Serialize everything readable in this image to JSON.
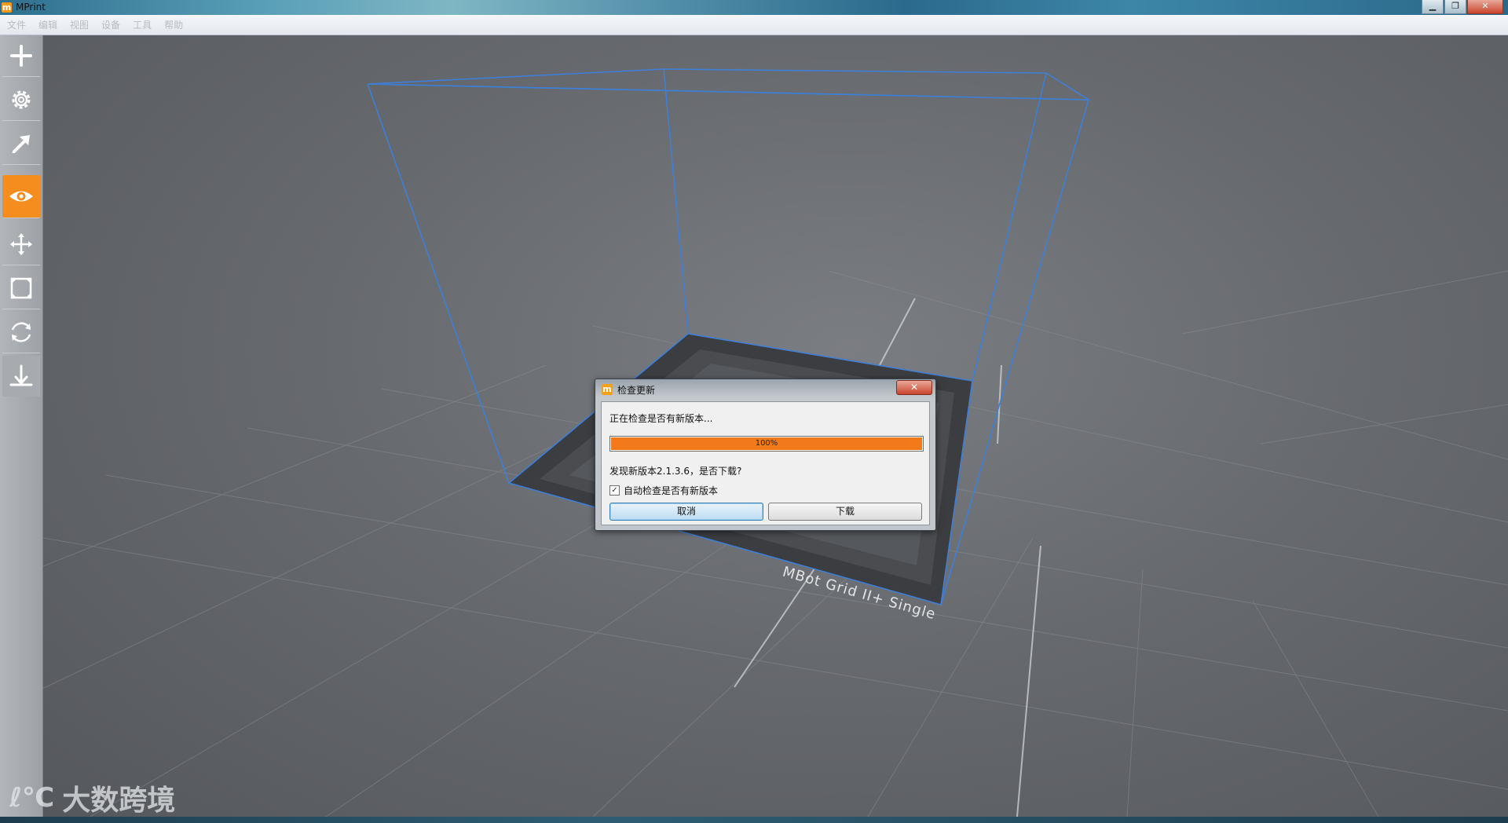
{
  "window": {
    "title": "MPrint",
    "logo": "m",
    "controls": {
      "minimize": "▁",
      "maximize": "❐",
      "close": "✕"
    }
  },
  "menu": [
    "文件",
    "编辑",
    "视图",
    "设备",
    "工具",
    "帮助"
  ],
  "toolbar": {
    "items": [
      {
        "name": "add-icon",
        "active": false
      },
      {
        "name": "gear-icon",
        "active": false
      },
      {
        "name": "print-arrow-icon",
        "active": false
      },
      {
        "name": "eye-view-icon",
        "active": true
      },
      {
        "name": "move-icon",
        "active": false
      },
      {
        "name": "scale-icon",
        "active": false
      },
      {
        "name": "rotate-icon",
        "active": false
      },
      {
        "name": "lay-flat-icon",
        "active": false
      }
    ],
    "accent": "#f58d1e"
  },
  "scene": {
    "printer_label": "MBot Grid II+ Single",
    "box_color": "#3f7fd6"
  },
  "dialog": {
    "title": "检查更新",
    "close": "✕",
    "status": "正在检查是否有新版本...",
    "progress_percent": 100,
    "progress_label": "100%",
    "found": "发现新版本2.1.3.6，是否下载?",
    "auto_check_label": "自动检查是否有新版本",
    "auto_check_mark": "✓",
    "auto_check_checked": true,
    "cancel_label": "取消",
    "download_label": "下载",
    "progress_color": "#f27a1a"
  },
  "watermark": {
    "mark": "ℓ℃",
    "text": "大数跨境"
  }
}
